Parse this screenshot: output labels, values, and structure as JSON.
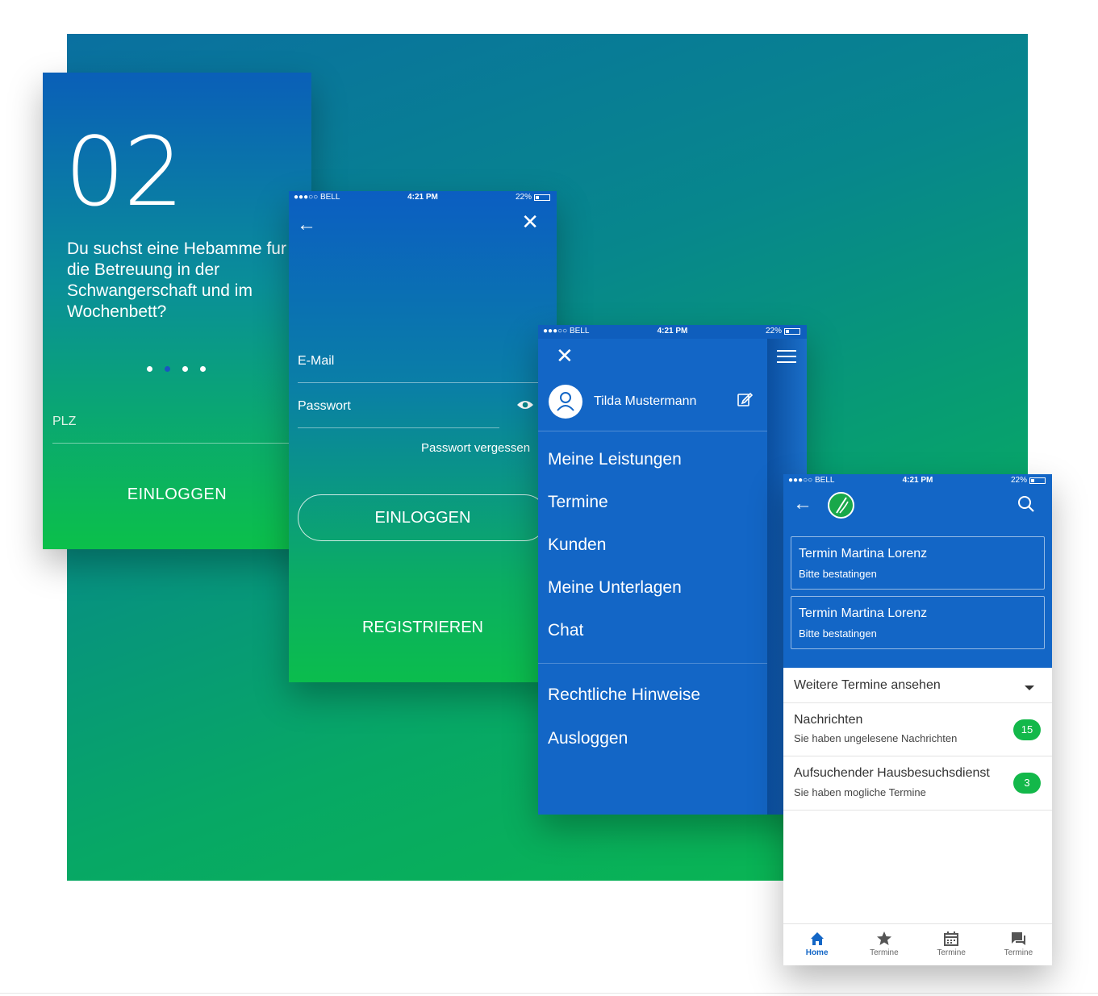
{
  "onboarding": {
    "step": "02",
    "text": "Du suchst eine Hebamme fur die Betreuung in der Schwangerschaft und im Wochenbett?",
    "plz_label": "PLZ",
    "login_label": "EINLOGGEN"
  },
  "status_bar": {
    "carrier": "●●●○○ BELL",
    "time": "4:21 PM",
    "battery": "22%"
  },
  "login": {
    "email_label": "E-Mail",
    "password_label": "Passwort",
    "forgot_label": "Passwort vergessen",
    "login_button": "EINLOGGEN",
    "register_label": "REGISTRIEREN"
  },
  "menu": {
    "user_name": "Tilda Mustermann",
    "items": [
      "Meine Leistungen",
      "Termine",
      "Kunden",
      "Meine Unterlagen",
      "Chat"
    ],
    "secondary_items": [
      "Rechtliche Hinweise",
      "Ausloggen"
    ]
  },
  "home": {
    "appointments": [
      {
        "title": "Termin Martina Lorenz",
        "subtitle": "Bitte bestatingen"
      },
      {
        "title": "Termin Martina Lorenz",
        "subtitle": "Bitte bestatingen"
      }
    ],
    "more_label": "Weitere Termine ansehen",
    "rows": [
      {
        "title": "Nachrichten",
        "subtitle": "Sie haben ungelesene Nachrichten",
        "count": "15"
      },
      {
        "title": "Aufsuchender Hausbesuchsdienst",
        "subtitle": "Sie haben mogliche Termine",
        "count": "3"
      }
    ],
    "tabs": [
      {
        "label": "Home",
        "icon": "home-icon"
      },
      {
        "label": "Termine",
        "icon": "star-icon"
      },
      {
        "label": "Termine",
        "icon": "calendar-icon"
      },
      {
        "label": "Termine",
        "icon": "chat-icon"
      }
    ]
  },
  "colors": {
    "primary_blue": "#1366c6",
    "accent_green": "#13b84a"
  }
}
